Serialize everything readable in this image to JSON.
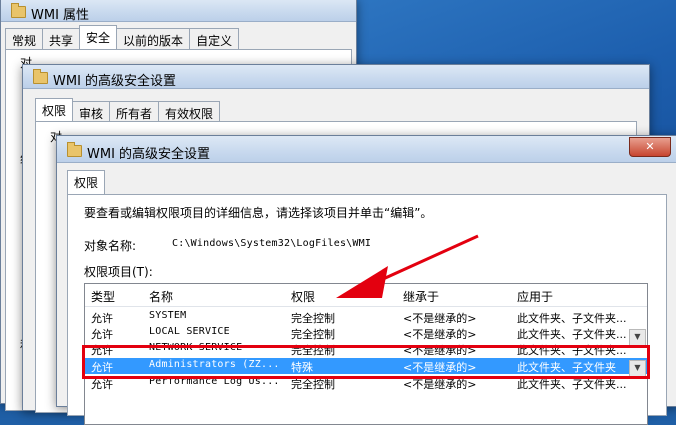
{
  "window1": {
    "title": "WMI 属性",
    "tabs": [
      "常规",
      "共享",
      "安全",
      "以前的版本",
      "自定义"
    ],
    "active_tab": 2,
    "partial_text": "对",
    "partial_text2": "组",
    "partial_text3": "和"
  },
  "window2": {
    "title": "WMI 的高级安全设置",
    "tabs": [
      "权限",
      "审核",
      "所有者",
      "有效权限"
    ],
    "active_tab": 0,
    "partial_text": "对"
  },
  "window3": {
    "title": "WMI 的高级安全设置",
    "close_label": "✕",
    "tabs": [
      "权限"
    ],
    "instruction": "要查看或编辑权限项目的详细信息，请选择该项目并单击“编辑”。",
    "object_name_label": "对象名称:",
    "object_name_value": "C:\\Windows\\System32\\LogFiles\\WMI",
    "entries_label": "权限项目(T):",
    "columns": [
      "类型",
      "名称",
      "权限",
      "继承于",
      "应用于"
    ],
    "rows": [
      {
        "type": "允许",
        "name": "SYSTEM",
        "permission": "完全控制",
        "inherited": "<不是继承的>",
        "applies": "此文件夹、子文件夹..."
      },
      {
        "type": "允许",
        "name": "LOCAL SERVICE",
        "permission": "完全控制",
        "inherited": "<不是继承的>",
        "applies": "此文件夹、子文件夹..."
      },
      {
        "type": "允许",
        "name": "NETWORK SERVICE",
        "permission": "完全控制",
        "inherited": "<不是继承的>",
        "applies": "此文件夹、子文件夹..."
      },
      {
        "type": "允许",
        "name": "Administrators (ZZ...",
        "permission": "特殊",
        "inherited": "<不是继承的>",
        "applies": "此文件夹、子文件夹"
      },
      {
        "type": "允许",
        "name": "Performance Log Us...",
        "permission": "完全控制",
        "inherited": "<不是继承的>",
        "applies": "此文件夹、子文件夹..."
      }
    ],
    "selected_row": 3
  },
  "colors": {
    "annotation_red": "#e3000f",
    "selection_blue": "#3399ff"
  }
}
